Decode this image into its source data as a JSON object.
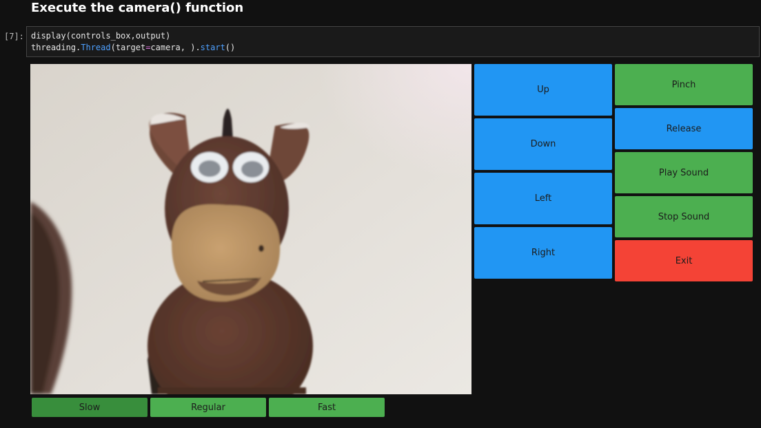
{
  "heading": "Execute the camera() function",
  "cell": {
    "prompt": "[7]:",
    "line1": "display(controls_box,output)",
    "line2_part1": "threading.",
    "line2_part2": "Thread",
    "line2_part3": "(target",
    "line2_part4": "=",
    "line2_part5": "camera, ).",
    "line2_part6": "start",
    "line2_part7": "()"
  },
  "directions": {
    "up": "Up",
    "down": "Down",
    "left": "Left",
    "right": "Right"
  },
  "actions": {
    "pinch": "Pinch",
    "release": "Release",
    "play_sound": "Play Sound",
    "stop_sound": "Stop Sound",
    "exit": "Exit"
  },
  "speeds": {
    "slow": "Slow",
    "regular": "Regular",
    "fast": "Fast"
  },
  "colors": {
    "blue": "#2196f3",
    "green": "#4caf50",
    "red": "#f44336",
    "selected_green": "#388e3c"
  }
}
